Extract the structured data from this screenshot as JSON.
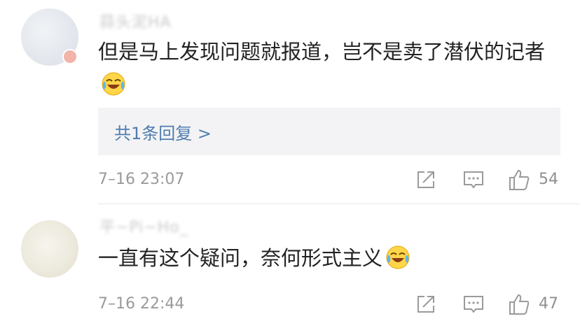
{
  "comments": [
    {
      "username": "蒜头泥HA",
      "text": "但是马上发现问题就报道，岂不是卖了潜伏的记者",
      "reply_link": "共1条回复 >",
      "timestamp": "7–16 23:07",
      "likes": "54",
      "emoji": "laughing-tears-emoji"
    },
    {
      "username": "平~Pi~Ho_",
      "text": "一直有这个疑问，奈何形式主义",
      "timestamp": "7–16 22:44",
      "likes": "47",
      "emoji": "laughing-tears-emoji"
    }
  ],
  "icons": [
    "share-icon",
    "comment-icon",
    "like-icon"
  ]
}
